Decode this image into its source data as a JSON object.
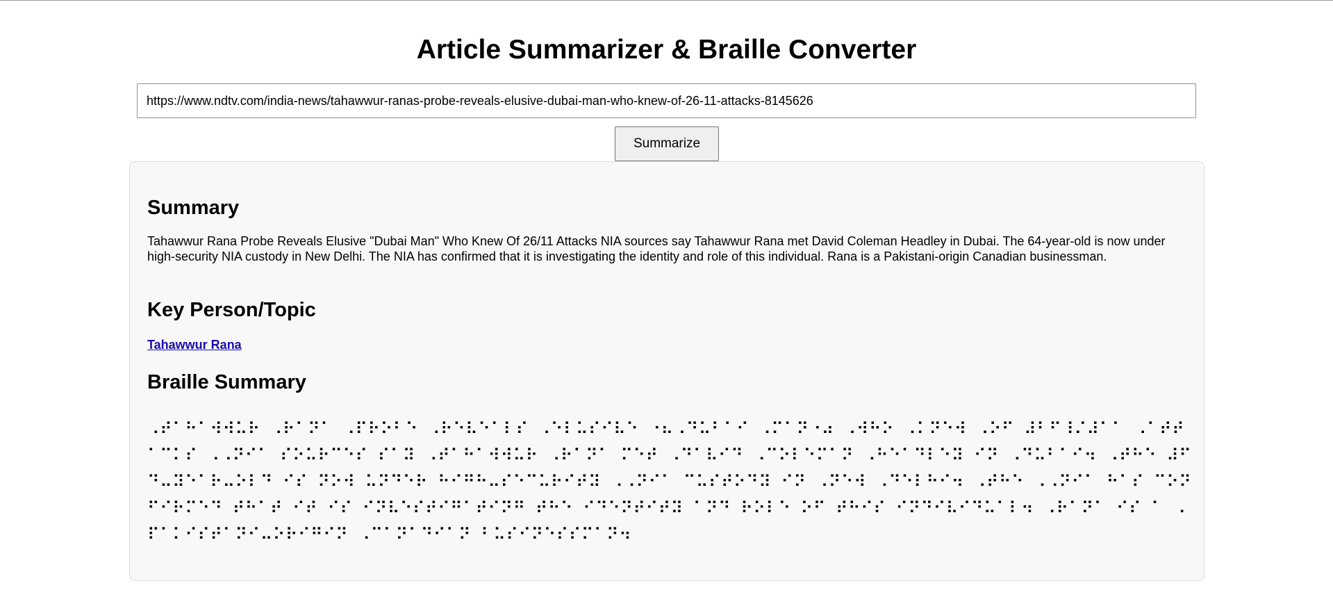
{
  "page": {
    "title": "Article Summarizer & Braille Converter"
  },
  "form": {
    "url_value": "https://www.ndtv.com/india-news/tahawwur-ranas-probe-reveals-elusive-dubai-man-who-knew-of-26-11-attacks-8145626",
    "button_label": "Summarize"
  },
  "results": {
    "summary_heading": "Summary",
    "summary_text": "Tahawwur Rana Probe Reveals Elusive \"Dubai Man\" Who Knew Of 26/11 Attacks NIA sources say Tahawwur Rana met David Coleman Headley in Dubai. The 64-year-old is now under high-security NIA custody in New Delhi. The NIA has confirmed that it is investigating the identity and role of this individual. Rana is a Pakistani-origin Canadian businessman.",
    "key_heading": "Key Person/Topic",
    "key_person": "Tahawwur Rana",
    "braille_heading": "Braille Summary",
    "braille_text": "⠠⠞⠁⠓⠁⠺⠺⠥⠗ ⠠⠗⠁⠝⠁ ⠠⠏⠗⠕⠃⠑ ⠠⠗⠑⠧⠑⠁⠇⠎ ⠠⠑⠇⠥⠎⠊⠧⠑ ⠐⠦⠠⠙⠥⠃⠁⠊ ⠠⠍⠁⠝⠐⠴ ⠠⠺⠓⠕ ⠠⠅⠝⠑⠺ ⠠⠕⠋ ⠼⠃⠋⠸⠌⠼⠁⠁ ⠠⠁⠞⠞⠁⠉⠅⠎ ⠠⠠⠝⠊⠁ ⠎⠕⠥⠗⠉⠑⠎ ⠎⠁⠽ ⠠⠞⠁⠓⠁⠺⠺⠥⠗ ⠠⠗⠁⠝⠁ ⠍⠑⠞ ⠠⠙⠁⠧⠊⠙ ⠠⠉⠕⠇⠑⠍⠁⠝ ⠠⠓⠑⠁⠙⠇⠑⠽ ⠊⠝ ⠠⠙⠥⠃⠁⠊⠲ ⠠⠞⠓⠑ ⠼⠋⠙⠤⠽⠑⠁⠗⠤⠕⠇⠙ ⠊⠎ ⠝⠕⠺ ⠥⠝⠙⠑⠗ ⠓⠊⠛⠓⠤⠎⠑⠉⠥⠗⠊⠞⠽ ⠠⠠⠝⠊⠁ ⠉⠥⠎⠞⠕⠙⠽ ⠊⠝ ⠠⠝⠑⠺ ⠠⠙⠑⠇⠓⠊⠲ ⠠⠞⠓⠑ ⠠⠠⠝⠊⠁ ⠓⠁⠎ ⠉⠕⠝⠋⠊⠗⠍⠑⠙ ⠞⠓⠁⠞ ⠊⠞ ⠊⠎ ⠊⠝⠧⠑⠎⠞⠊⠛⠁⠞⠊⠝⠛ ⠞⠓⠑ ⠊⠙⠑⠝⠞⠊⠞⠽ ⠁⠝⠙ ⠗⠕⠇⠑ ⠕⠋ ⠞⠓⠊⠎ ⠊⠝⠙⠊⠧⠊⠙⠥⠁⠇⠲ ⠠⠗⠁⠝⠁ ⠊⠎ ⠁ ⠠⠏⠁⠅⠊⠎⠞⠁⠝⠊⠤⠕⠗⠊⠛⠊⠝ ⠠⠉⠁⠝⠁⠙⠊⠁⠝ ⠃⠥⠎⠊⠝⠑⠎⠎⠍⠁⠝⠲"
  }
}
